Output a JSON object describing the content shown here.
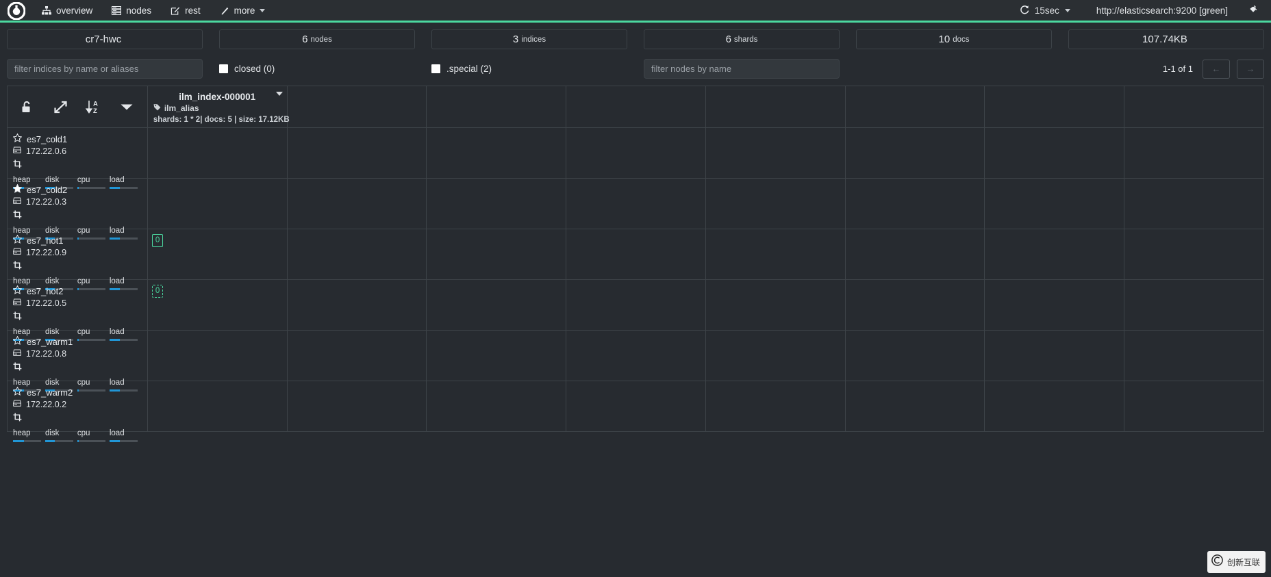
{
  "header": {
    "brand_icon": "cerebro-logo-icon",
    "nav": [
      {
        "label": "overview",
        "icon": "sitemap-icon"
      },
      {
        "label": "nodes",
        "icon": "server-list-icon"
      },
      {
        "label": "rest",
        "icon": "edit-square-icon"
      },
      {
        "label": "more",
        "icon": "magic-wand-icon",
        "has_caret": true
      }
    ],
    "refresh": {
      "label": "15sec",
      "icon": "refresh-icon",
      "has_caret": true
    },
    "cluster_url": "http://elasticsearch:9200 [green]",
    "disconnect_icon": "plug-icon",
    "accent_color": "#4bd8a0"
  },
  "stats": [
    {
      "value": "cr7-hwc",
      "unit": ""
    },
    {
      "value": "6",
      "unit": "nodes"
    },
    {
      "value": "3",
      "unit": "indices"
    },
    {
      "value": "6",
      "unit": "shards"
    },
    {
      "value": "10",
      "unit": "docs"
    },
    {
      "value": "107.74KB",
      "unit": ""
    }
  ],
  "filters": {
    "index_filter": {
      "placeholder": "filter indices by name or aliases",
      "value": ""
    },
    "closed": {
      "label": "closed (0)",
      "checked": false
    },
    "special": {
      "label": ".special (2)",
      "checked": false
    },
    "node_filter": {
      "placeholder": "filter nodes by name",
      "value": ""
    },
    "pager": {
      "label": "1-1 of 1",
      "prev": "←",
      "next": "→"
    }
  },
  "grid": {
    "header_actions": [
      {
        "icon": "unlock-icon",
        "name": "toggle-cluster-lock"
      },
      {
        "icon": "expand-arrows-icon",
        "name": "toggle-expand"
      },
      {
        "icon": "sort-az-icon",
        "name": "sort-az"
      },
      {
        "icon": "caret-down-icon",
        "name": "grid-options"
      }
    ],
    "indices": [
      {
        "name": "ilm_index-000001",
        "alias": "ilm_alias",
        "alias_icon": "tag-icon",
        "meta": "shards: 1 * 2| docs: 5 | size: 17.12KB",
        "caret_icon": "caret-down-icon"
      }
    ],
    "nodes": [
      {
        "name": "es7_cold1",
        "ip": "172.22.0.6",
        "star_icon": "star-outline-icon",
        "master": false,
        "ip_icon": "server-icon",
        "role_icon": "crop-icon",
        "bars": [
          {
            "label": "heap",
            "pct": 38
          },
          {
            "label": "disk",
            "pct": 35
          },
          {
            "label": "cpu",
            "pct": 4
          },
          {
            "label": "load",
            "pct": 36
          }
        ],
        "shards": []
      },
      {
        "name": "es7_cold2",
        "ip": "172.22.0.3",
        "star_icon": "star-filled-icon",
        "master": true,
        "ip_icon": "server-icon",
        "role_icon": "crop-icon",
        "bars": [
          {
            "label": "heap",
            "pct": 38
          },
          {
            "label": "disk",
            "pct": 35
          },
          {
            "label": "cpu",
            "pct": 4
          },
          {
            "label": "load",
            "pct": 36
          }
        ],
        "shards": []
      },
      {
        "name": "es7_hot1",
        "ip": "172.22.0.9",
        "star_icon": "star-outline-icon",
        "master": false,
        "ip_icon": "server-icon",
        "role_icon": "crop-icon",
        "bars": [
          {
            "label": "heap",
            "pct": 38
          },
          {
            "label": "disk",
            "pct": 35
          },
          {
            "label": "cpu",
            "pct": 4
          },
          {
            "label": "load",
            "pct": 36
          }
        ],
        "shards": [
          {
            "label": "0",
            "type": "primary"
          }
        ]
      },
      {
        "name": "es7_hot2",
        "ip": "172.22.0.5",
        "star_icon": "star-outline-icon",
        "master": false,
        "ip_icon": "server-icon",
        "role_icon": "crop-icon",
        "bars": [
          {
            "label": "heap",
            "pct": 38
          },
          {
            "label": "disk",
            "pct": 35
          },
          {
            "label": "cpu",
            "pct": 4
          },
          {
            "label": "load",
            "pct": 36
          }
        ],
        "shards": [
          {
            "label": "0",
            "type": "replica"
          }
        ]
      },
      {
        "name": "es7_warm1",
        "ip": "172.22.0.8",
        "star_icon": "star-outline-icon",
        "master": false,
        "ip_icon": "server-icon",
        "role_icon": "crop-icon",
        "bars": [
          {
            "label": "heap",
            "pct": 38
          },
          {
            "label": "disk",
            "pct": 35
          },
          {
            "label": "cpu",
            "pct": 4
          },
          {
            "label": "load",
            "pct": 36
          }
        ],
        "shards": []
      },
      {
        "name": "es7_warm2",
        "ip": "172.22.0.2",
        "star_icon": "star-outline-icon",
        "master": false,
        "ip_icon": "server-icon",
        "role_icon": "crop-icon",
        "bars": [
          {
            "label": "heap",
            "pct": 38
          },
          {
            "label": "disk",
            "pct": 35
          },
          {
            "label": "cpu",
            "pct": 4
          },
          {
            "label": "load",
            "pct": 36
          }
        ],
        "shards": []
      }
    ],
    "empty_columns": 7
  },
  "watermark": {
    "text": "创新互联",
    "icon": "watermark-logo-icon"
  }
}
